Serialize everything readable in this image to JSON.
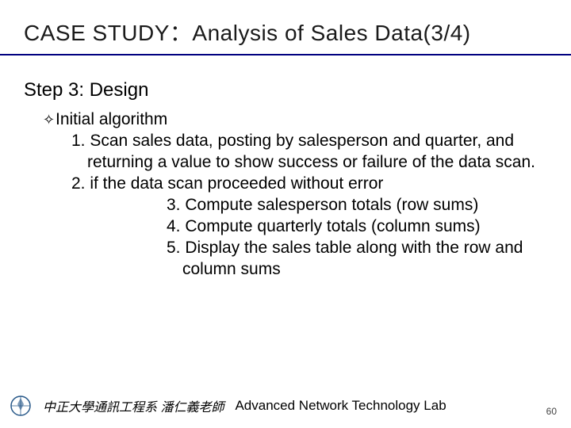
{
  "title": "CASE STUDY：Analysis of Sales Data(3/4)",
  "step_heading": "Step 3: Design",
  "bullet": {
    "icon": "✧",
    "label": "Initial algorithm"
  },
  "items": {
    "one": "1. Scan sales data, posting by salesperson and quarter, and returning a value to show success or failure of the data scan.",
    "two": "2. if the data scan proceeded without error",
    "three": "3. Compute salesperson totals (row sums)",
    "four": "4. Compute quarterly totals (column sums)",
    "five": "5. Display the sales table along with the row and column sums"
  },
  "footer": {
    "cn": "中正大學通訊工程系 潘仁義老師",
    "en": "Advanced Network Technology Lab"
  },
  "page_number": "60"
}
